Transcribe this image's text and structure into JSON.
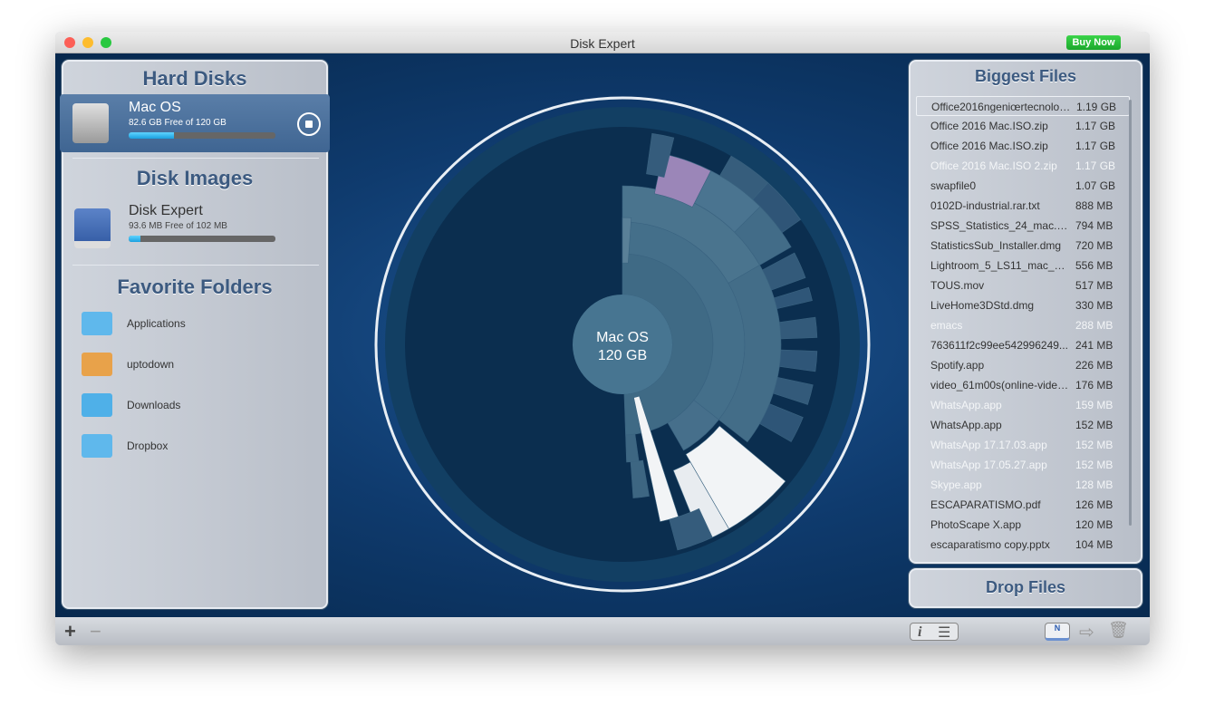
{
  "window": {
    "title": "Disk Expert",
    "buy_label": "Buy Now",
    "buy_color": "#22b634"
  },
  "sidebar": {
    "hard_disks_title": "Hard Disks",
    "hard_disks": [
      {
        "name": "Mac OS",
        "info": "82.6 GB Free of 120 GB",
        "used_percent": 31,
        "icon": "hard-drive-icon",
        "action_icon": "eject-stop-icon"
      }
    ],
    "disk_images_title": "Disk Images",
    "disk_images": [
      {
        "name": "Disk Expert",
        "info": "93.6 MB Free of 102 MB",
        "used_percent": 8,
        "icon": "disk-image-icon"
      }
    ],
    "favorites_title": "Favorite Folders",
    "favorites": [
      {
        "label": "Applications",
        "icon": "applications-folder-icon"
      },
      {
        "label": "uptodown",
        "icon": "home-folder-icon"
      },
      {
        "label": "Downloads",
        "icon": "downloads-folder-icon"
      },
      {
        "label": "Dropbox",
        "icon": "dropbox-folder-icon"
      }
    ]
  },
  "chart": {
    "center_name": "Mac OS",
    "center_size": "120 GB"
  },
  "biggest_files": {
    "title": "Biggest Files",
    "items": [
      {
        "name": "Office2016ngeniœrtecnologi...",
        "size": "1.19 GB",
        "selected": true
      },
      {
        "name": "Office 2016 Mac.ISO.zip",
        "size": "1.17 GB"
      },
      {
        "name": "Office 2016 Mac.ISO.zip",
        "size": "1.17 GB"
      },
      {
        "name": "Office 2016 Mac.ISO 2.zip",
        "size": "1.17 GB",
        "white": true
      },
      {
        "name": "swapfile0",
        "size": "1.07 GB"
      },
      {
        "name": "0102D-industrial.rar.txt",
        "size": "888 MB"
      },
      {
        "name": "SPSS_Statistics_24_mac.dmg",
        "size": "794 MB"
      },
      {
        "name": "StatisticsSub_Installer.dmg",
        "size": "720 MB"
      },
      {
        "name": "Lightroom_5_LS11_mac_5_7...",
        "size": "556 MB"
      },
      {
        "name": "TOUS.mov",
        "size": "517 MB"
      },
      {
        "name": "LiveHome3DStd.dmg",
        "size": "330 MB"
      },
      {
        "name": "emacs",
        "size": "288 MB",
        "white": true
      },
      {
        "name": "763611f2c99ee542996249...",
        "size": "241 MB"
      },
      {
        "name": "Spotify.app",
        "size": "226 MB"
      },
      {
        "name": "video_61m00s(online-video-...",
        "size": "176 MB"
      },
      {
        "name": "WhatsApp.app",
        "size": "159 MB",
        "white": true
      },
      {
        "name": "WhatsApp.app",
        "size": "152 MB"
      },
      {
        "name": "WhatsApp 17.17.03.app",
        "size": "152 MB",
        "white": true
      },
      {
        "name": "WhatsApp 17.05.27.app",
        "size": "152 MB",
        "white": true
      },
      {
        "name": "Skype.app",
        "size": "128 MB",
        "white": true
      },
      {
        "name": "ESCAPARATISMO.pdf",
        "size": "126 MB"
      },
      {
        "name": "PhotoScape X.app",
        "size": "120 MB"
      },
      {
        "name": "escaparatismo copy.pptx",
        "size": "104 MB"
      }
    ]
  },
  "drop_files_label": "Drop Files",
  "toolbar": {
    "add": "+",
    "remove": "−",
    "info": "i",
    "list": "☰",
    "note": "N",
    "move": "⇨",
    "trash": "🗑"
  }
}
